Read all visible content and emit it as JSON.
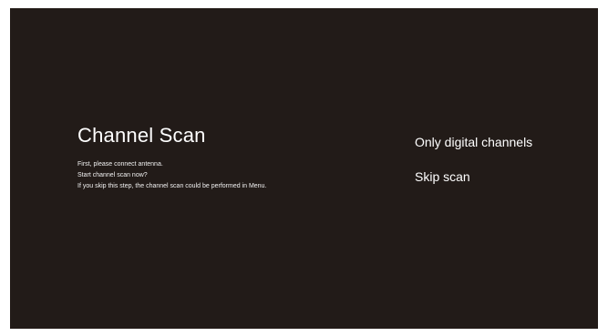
{
  "screen": {
    "title": "Channel Scan",
    "description": [
      "First, please connect antenna.",
      "Start channel scan now?",
      "If you skip this step, the channel scan could be performed in  Menu."
    ],
    "options": [
      "Only digital channels",
      "Skip scan"
    ]
  },
  "colors": {
    "background": "#221b18",
    "text": "#ffffff"
  }
}
